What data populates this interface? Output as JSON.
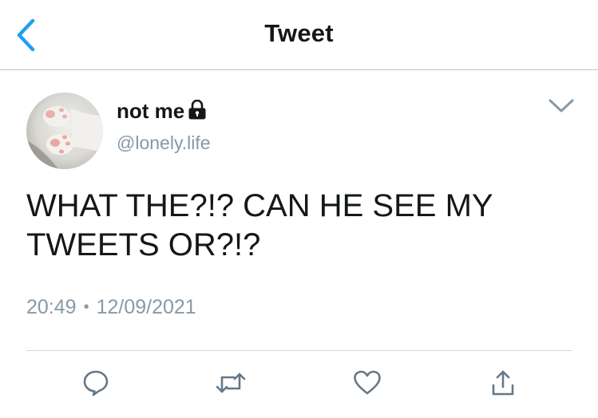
{
  "header": {
    "title": "Tweet",
    "back_icon": "chevron-left-icon",
    "accent_color": "#1da1f2"
  },
  "tweet": {
    "author": {
      "display_name": "not me",
      "handle": "@lonely.life",
      "protected_icon": "lock-icon"
    },
    "text": "WHAT THE?!? CAN HE SEE MY\nTWEETS OR?!?",
    "time": "20:49",
    "separator": "•",
    "date": "12/09/2021",
    "menu_icon": "chevron-down-icon"
  },
  "actions": [
    {
      "name": "reply",
      "icon": "speech-bubble-icon"
    },
    {
      "name": "retweet",
      "icon": "retweet-icon"
    },
    {
      "name": "like",
      "icon": "heart-icon"
    },
    {
      "name": "share",
      "icon": "share-icon"
    }
  ],
  "colors": {
    "text": "#14171a",
    "secondary": "#8899a6",
    "divider": "#d3d9de",
    "icon": "#657786"
  }
}
